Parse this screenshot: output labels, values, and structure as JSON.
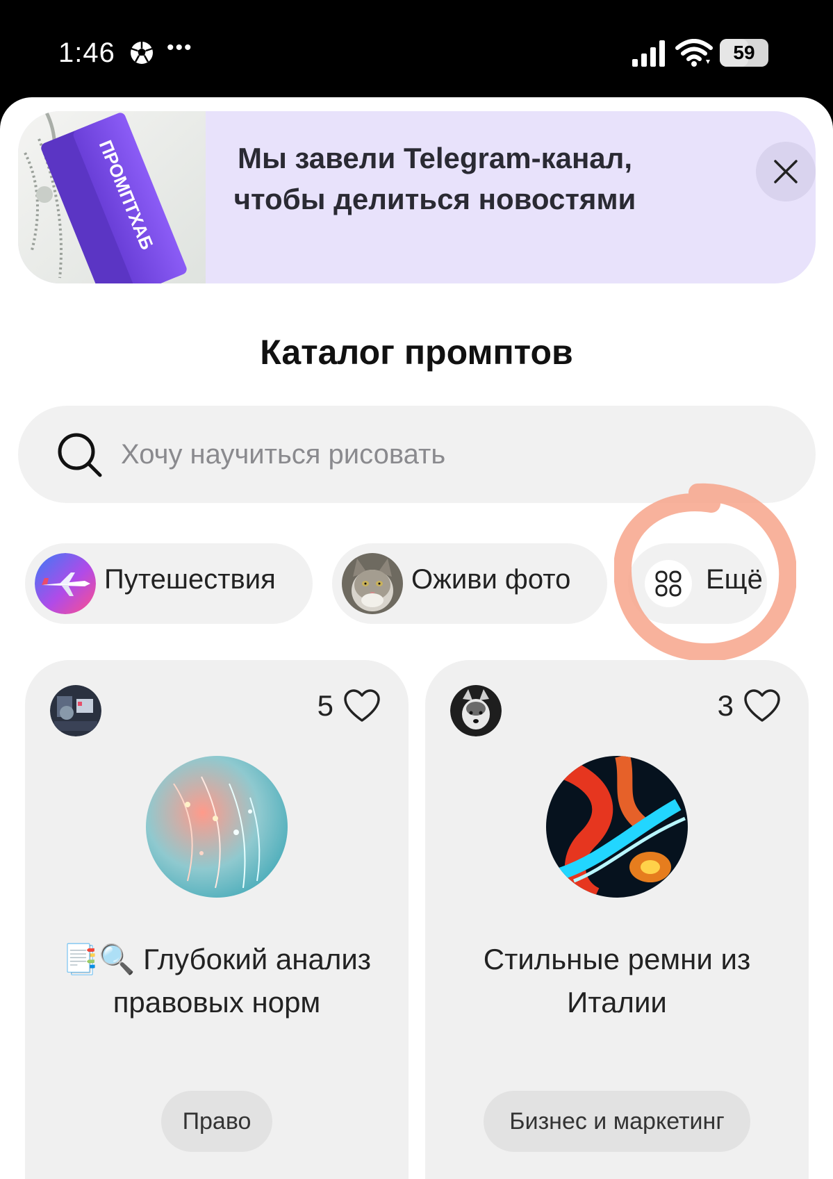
{
  "status_bar": {
    "time": "1:46",
    "dots": "•••",
    "battery_level": "59",
    "icons": [
      "soccer-ball-icon",
      "signal-icon",
      "wifi-icon",
      "battery-icon"
    ]
  },
  "banner": {
    "text": "Мы завели Telegram-канал, чтобы делиться новостями",
    "image_icon": "keychain-image"
  },
  "page": {
    "title": "Каталог промптов"
  },
  "search": {
    "placeholder": "Хочу научиться рисовать",
    "value": ""
  },
  "chips": [
    {
      "label": "Путешествия",
      "icon": "airplane-image"
    },
    {
      "label": "Оживи фото",
      "icon": "cat-image"
    },
    {
      "label": "Ещё",
      "icon": "grid-icon"
    }
  ],
  "cards": [
    {
      "likes": "5",
      "title": "📑🔍 Глубокий анализ правовых норм",
      "tag": "Право"
    },
    {
      "likes": "3",
      "title": "Стильные ремни из Италии",
      "tag": "Бизнес и маркетинг"
    }
  ],
  "colors": {
    "banner_bg": "#e8e2fb",
    "chip_bg": "#f1f1f1",
    "card_bg": "#f0f0f0",
    "highlight": "#f7a58b"
  }
}
